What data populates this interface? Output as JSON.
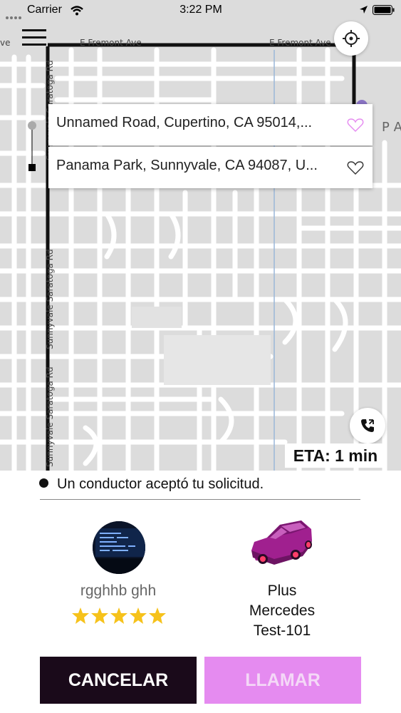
{
  "status_bar": {
    "carrier": "Carrier",
    "time": "3:22 PM"
  },
  "map": {
    "street_labels": [
      "E Fremont Ave",
      "E Fremont Ave",
      "ve",
      "Sunnyvale Saratoga Rd",
      "Sunnyvale Saratoga Rd",
      "Sunnyvale Saratoga Rd",
      "P A"
    ]
  },
  "route": {
    "origin": "Unnamed Road, Cupertino, CA 95014,...",
    "destination": "Panama Park, Sunnyvale, CA 94087, U..."
  },
  "eta": "ETA: 1 min",
  "status_message": "Un conductor aceptó tu solicitud.",
  "driver": {
    "name": "rgghhb ghh",
    "rating": 5
  },
  "vehicle": {
    "category": "Plus",
    "make": "Mercedes",
    "plate": "Test-101"
  },
  "actions": {
    "cancel_label": "CANCELAR",
    "call_label": "LLAMAR"
  },
  "colors": {
    "accent": "#e58bf0",
    "dark": "#1a0a1a",
    "star": "#f6c21b",
    "car": "#a0208f"
  }
}
